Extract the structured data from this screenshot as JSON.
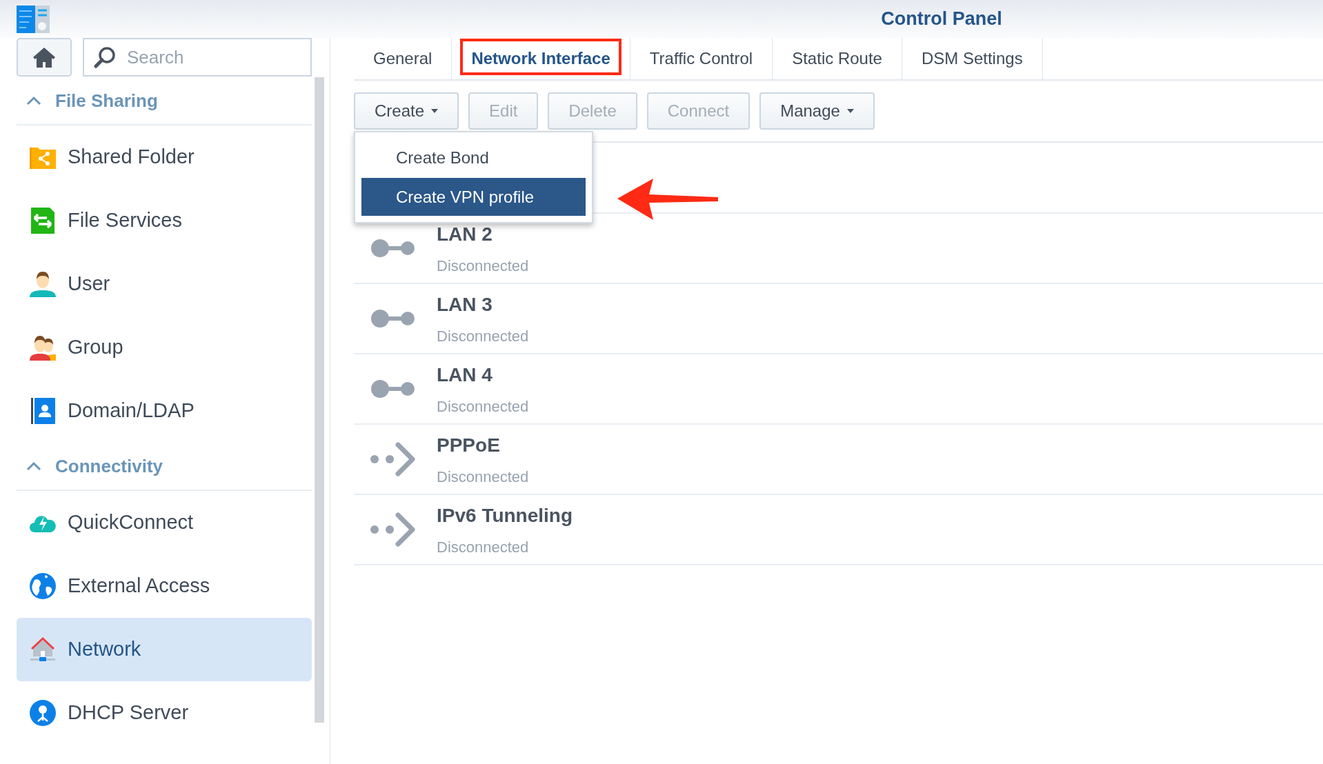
{
  "window": {
    "title": "Control Panel"
  },
  "sidebar": {
    "search": {
      "placeholder": "Search"
    },
    "groups": [
      {
        "label": "File Sharing",
        "expanded": true,
        "items": [
          {
            "label": "Shared Folder",
            "selected": false
          },
          {
            "label": "File Services",
            "selected": false
          },
          {
            "label": "User",
            "selected": false
          },
          {
            "label": "Group",
            "selected": false
          },
          {
            "label": "Domain/LDAP",
            "selected": false
          }
        ]
      },
      {
        "label": "Connectivity",
        "expanded": true,
        "items": [
          {
            "label": "QuickConnect",
            "selected": false
          },
          {
            "label": "External Access",
            "selected": false
          },
          {
            "label": "Network",
            "selected": true
          },
          {
            "label": "DHCP Server",
            "selected": false
          }
        ]
      }
    ]
  },
  "tabs": [
    {
      "label": "General",
      "selected": false,
      "annotated": false
    },
    {
      "label": "Network Interface",
      "selected": true,
      "annotated": true
    },
    {
      "label": "Traffic Control",
      "selected": false,
      "annotated": false
    },
    {
      "label": "Static Route",
      "selected": false,
      "annotated": false
    },
    {
      "label": "DSM Settings",
      "selected": false,
      "annotated": false
    }
  ],
  "toolbar": [
    {
      "label": "Create",
      "disabled": false,
      "dropdown": true,
      "menu": [
        {
          "label": "Create Bond",
          "selected": false,
          "annotated": false
        },
        {
          "label": "Create VPN profile",
          "selected": true,
          "annotated": true
        }
      ]
    },
    {
      "label": "Edit",
      "disabled": true,
      "dropdown": false
    },
    {
      "label": "Delete",
      "disabled": true,
      "dropdown": false
    },
    {
      "label": "Connect",
      "disabled": true,
      "dropdown": false
    },
    {
      "label": "Manage",
      "disabled": false,
      "dropdown": true
    }
  ],
  "interfaces": [
    {
      "kind": "lan",
      "name": "LAN 2",
      "status": "Disconnected"
    },
    {
      "kind": "lan",
      "name": "LAN 3",
      "status": "Disconnected"
    },
    {
      "kind": "lan",
      "name": "LAN 4",
      "status": "Disconnected"
    },
    {
      "kind": "tunnel",
      "name": "PPPoE",
      "status": "Disconnected"
    },
    {
      "kind": "tunnel",
      "name": "IPv6 Tunneling",
      "status": "Disconnected"
    }
  ]
}
